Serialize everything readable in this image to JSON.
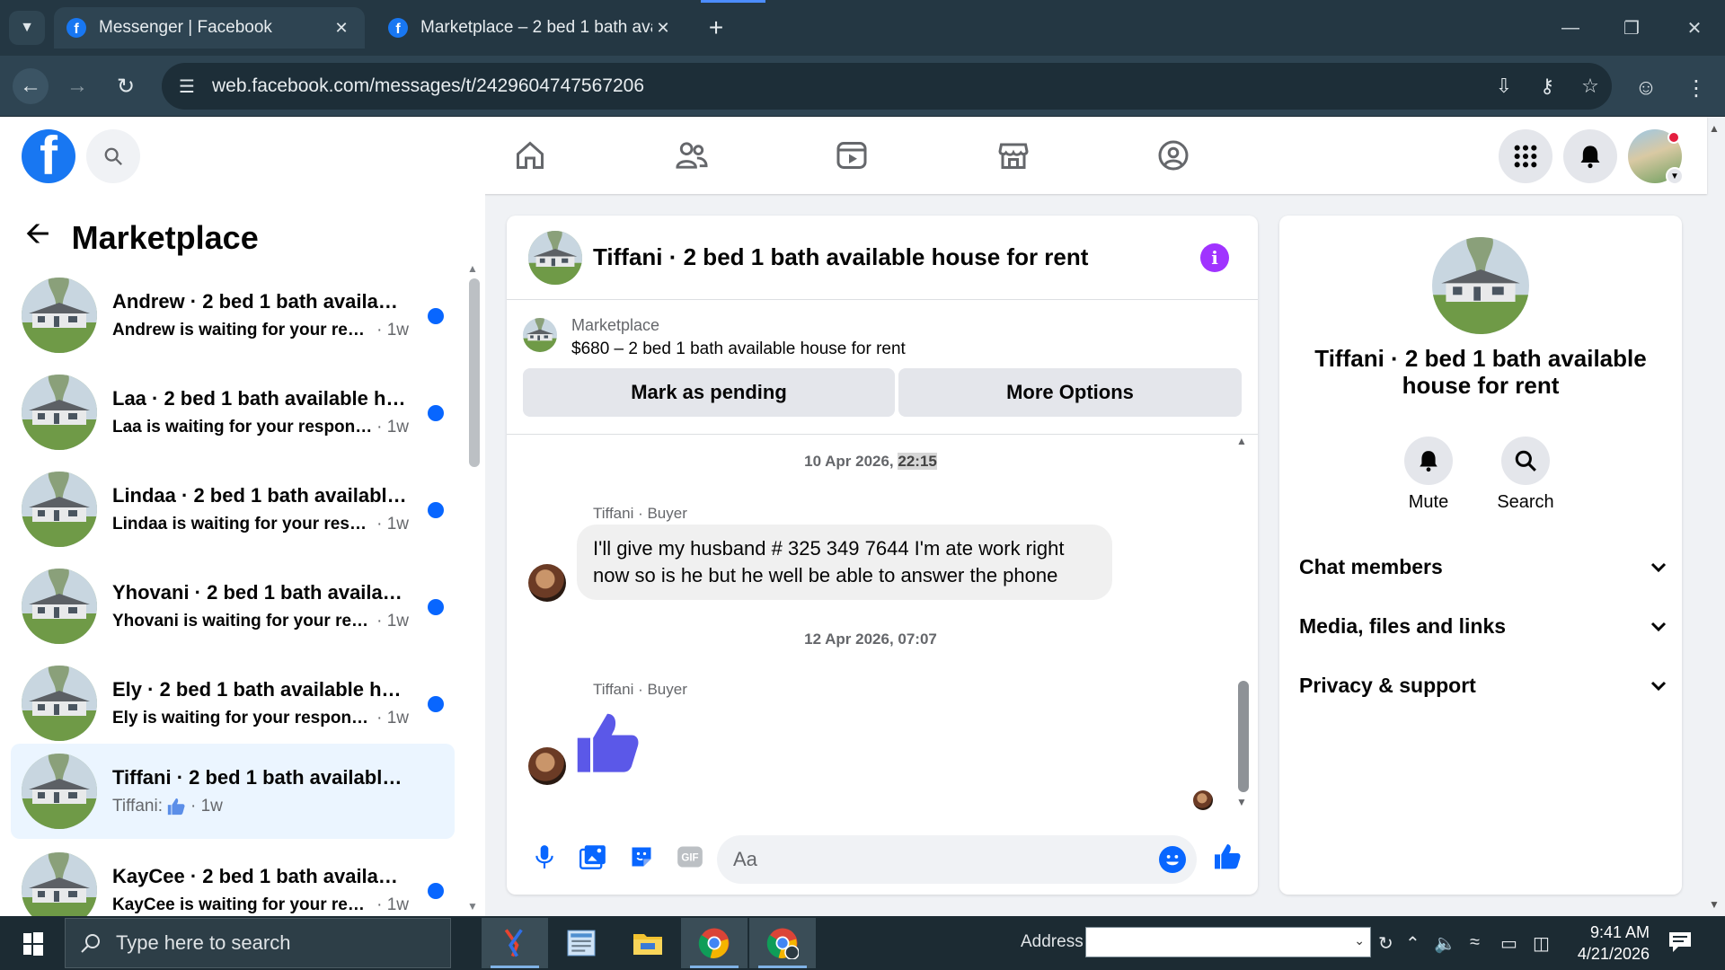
{
  "browser": {
    "tabs": [
      {
        "title": "Messenger | Facebook",
        "active": true
      },
      {
        "title": "Marketplace – 2 bed 1 bath ava",
        "active": false
      }
    ],
    "url": "web.facebook.com/messages/t/2429604747567206"
  },
  "sidebar": {
    "title": "Marketplace",
    "conversations": [
      {
        "name": "Andrew · 2 bed 1 bath availabl...",
        "message": "Andrew is waiting for your resp...",
        "time": "· 1w",
        "unread": true,
        "selected": false
      },
      {
        "name": "Laa · 2 bed 1 bath available ho...",
        "message": "Laa is waiting for your response.",
        "time": "· 1w",
        "unread": true,
        "selected": false
      },
      {
        "name": "Lindaa · 2 bed 1 bath available ...",
        "message": "Lindaa is waiting for your respo...",
        "time": "· 1w",
        "unread": true,
        "selected": false
      },
      {
        "name": "Yhovani · 2 bed 1 bath availabl...",
        "message": "Yhovani is waiting for your resp...",
        "time": "· 1w",
        "unread": true,
        "selected": false
      },
      {
        "name": "Ely · 2 bed 1 bath available ho...",
        "message": "Ely is waiting for your response.",
        "time": "· 1w",
        "unread": true,
        "selected": false
      },
      {
        "name": "Tiffani · 2 bed 1 bath available h...",
        "message": "Tiffani:",
        "time": "· 1w",
        "unread": false,
        "selected": true,
        "message_icon": "thumbs-up-icon"
      },
      {
        "name": "KayCee · 2 bed 1 bath availabl...",
        "message": "KayCee is waiting for your resp...",
        "time": "· 1w",
        "unread": true,
        "selected": false
      }
    ]
  },
  "chat": {
    "title": "Tiffani · 2 bed 1 bath available house for rent",
    "listing": {
      "label": "Marketplace",
      "item": "$680 – 2 bed 1 bath available house for rent",
      "mark_pending": "Mark as pending",
      "more_options": "More Options"
    },
    "messages": [
      {
        "date": "10 Apr 2026, ",
        "date_highlight": "22:15",
        "sender": "Tiffani · Buyer",
        "text": "I'll give my husband # 325 349 7644 I'm ate work right now so is he but he well be able to answer the phone"
      },
      {
        "date": "12 Apr 2026, 07:07",
        "sender": "Tiffani · Buyer",
        "sticker": "thumbs-up-icon"
      }
    ],
    "composer_placeholder": "Aa"
  },
  "info_panel": {
    "title": "Tiffani · 2 bed 1 bath available house for rent",
    "mute_label": "Mute",
    "search_label": "Search",
    "sections": [
      "Chat members",
      "Media, files and links",
      "Privacy & support"
    ]
  },
  "taskbar": {
    "search_placeholder": "Type here to search",
    "address_label": "Address",
    "time": "9:41 AM",
    "date": "4/21/2026"
  },
  "colors": {
    "facebook_blue": "#1877f2",
    "unread_dot": "#0866ff",
    "info_icon": "#a033ff",
    "like_sticker": "#5b58e8",
    "selected_row": "#ebf5ff"
  }
}
